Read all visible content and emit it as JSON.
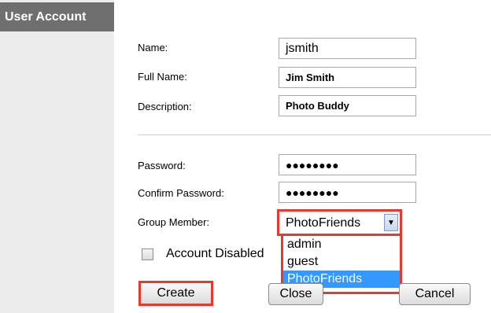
{
  "sidebar": {
    "title": "User Account"
  },
  "form": {
    "name_label": "Name:",
    "name_value": "jsmith",
    "fullname_label": "Full Name:",
    "fullname_value": "Jim Smith",
    "description_label": "Description:",
    "description_value": "Photo Buddy",
    "password_label": "Password:",
    "password_mask": "●●●●●●●●",
    "confirm_label": "Confirm Password:",
    "confirm_mask": "●●●●●●●●",
    "group_label": "Group Member:",
    "group_selected": "PhotoFriends",
    "group_options": [
      "admin",
      "guest",
      "PhotoFriends"
    ],
    "account_disabled_label": "Account Disabled"
  },
  "buttons": {
    "create": "Create",
    "close": "Close",
    "cancel": "Cancel"
  },
  "colors": {
    "highlight": "#e53a2c",
    "selection": "#3399ff"
  }
}
